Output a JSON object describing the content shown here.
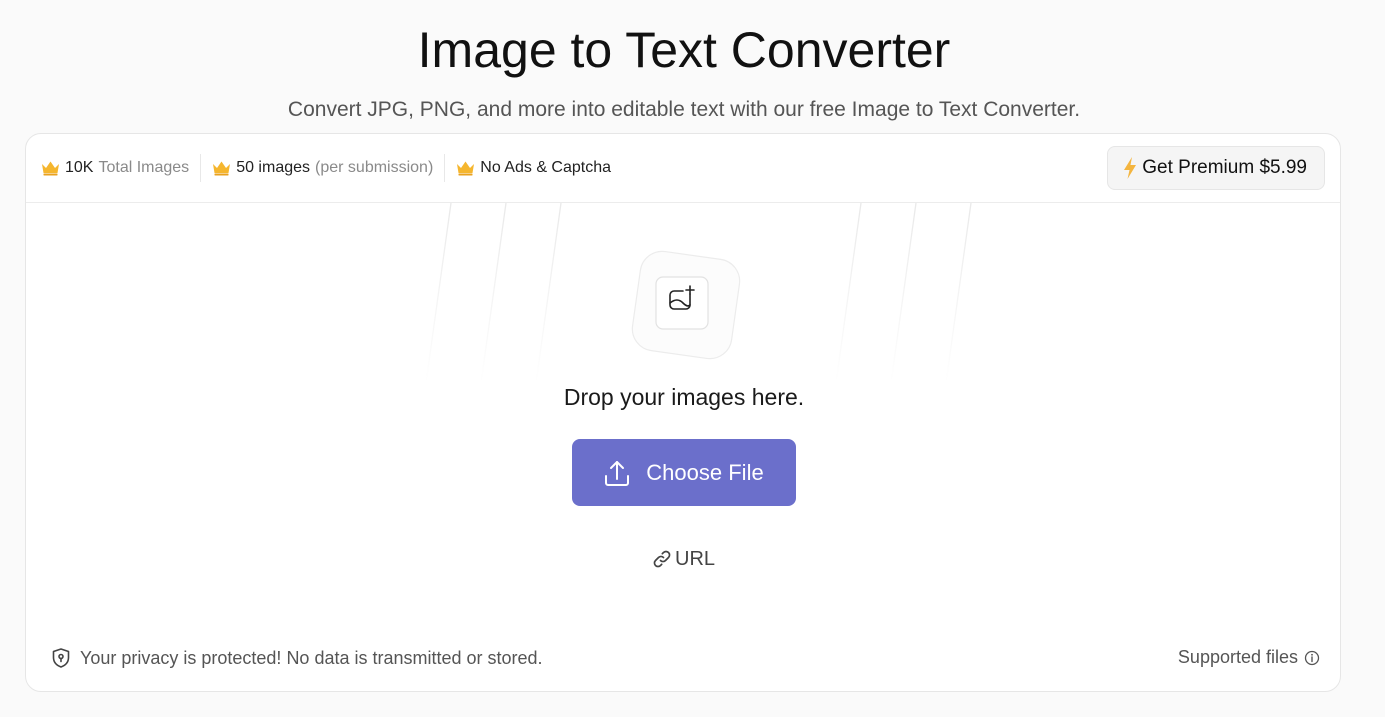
{
  "header": {
    "title": "Image to Text Converter",
    "subtitle": "Convert JPG, PNG, and more into editable text with our free Image to Text Converter."
  },
  "features": [
    {
      "icon": "crown-icon",
      "label": "10K",
      "detail": "Total Images"
    },
    {
      "icon": "crown-icon",
      "label": "50 images",
      "detail": "(per submission)"
    },
    {
      "icon": "crown-icon",
      "label": "No Ads & Captcha",
      "detail": ""
    }
  ],
  "premium": {
    "icon": "lightning-icon",
    "label": "Get Premium $5.99"
  },
  "dropzone": {
    "icon": "image-add-icon",
    "prompt": "Drop your images here.",
    "choose_label": "Choose File",
    "url_label": "URL"
  },
  "footer": {
    "privacy_text": "Your privacy is protected! No data is transmitted or stored.",
    "supported_label": "Supported files"
  },
  "colors": {
    "accent": "#6b6fcb",
    "crown": "#f5b62e",
    "bolt": "#f4b53f",
    "background": "#fafafa"
  }
}
